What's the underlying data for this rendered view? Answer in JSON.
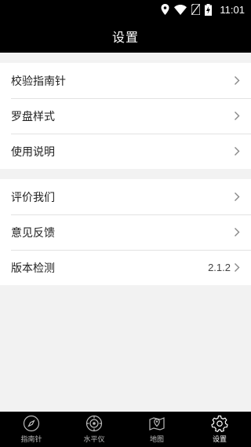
{
  "status_bar": {
    "time": "11:01"
  },
  "header": {
    "title": "设置"
  },
  "group1": {
    "items": [
      {
        "label": "校验指南针"
      },
      {
        "label": "罗盘样式"
      },
      {
        "label": "使用说明"
      }
    ]
  },
  "group2": {
    "items": [
      {
        "label": "评价我们"
      },
      {
        "label": "意见反馈"
      },
      {
        "label": "版本检测",
        "value": "2.1.2"
      }
    ]
  },
  "tab_bar": {
    "tabs": [
      {
        "label": "指南针",
        "icon": "compass-icon"
      },
      {
        "label": "水平仪",
        "icon": "level-icon"
      },
      {
        "label": "地图",
        "icon": "map-icon"
      },
      {
        "label": "设置",
        "icon": "gear-icon",
        "active": true
      }
    ]
  },
  "colors": {
    "bar": "#000000",
    "background": "#f2f2f2",
    "row": "#ffffff"
  }
}
